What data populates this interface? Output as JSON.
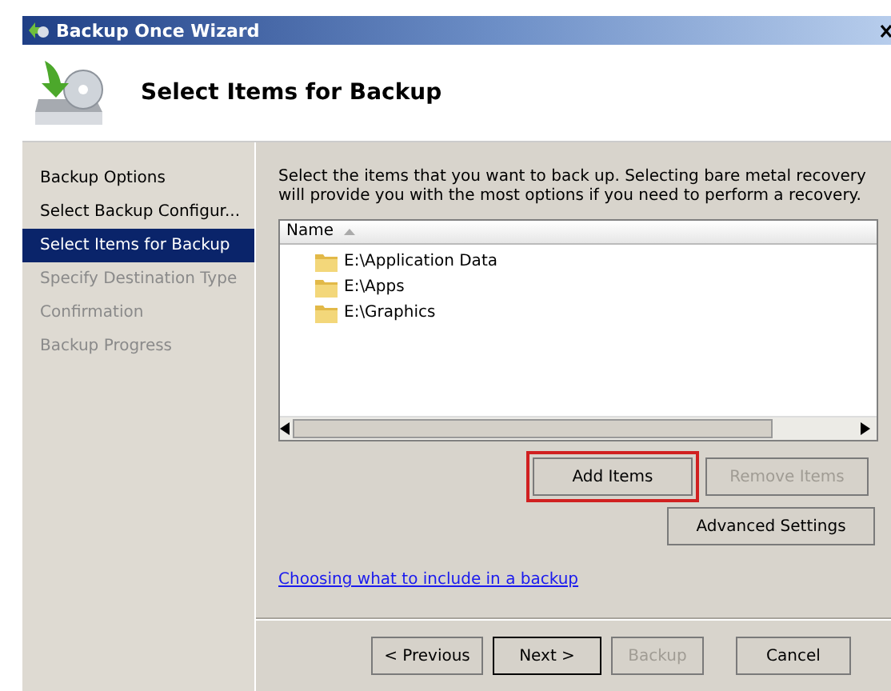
{
  "window": {
    "title": "Backup Once Wizard"
  },
  "header": {
    "title": "Select Items for Backup"
  },
  "sidebar": {
    "items": [
      {
        "label": "Backup Options",
        "selected": false,
        "disabled": false
      },
      {
        "label": "Select Backup Configur...",
        "selected": false,
        "disabled": false
      },
      {
        "label": "Select Items for Backup",
        "selected": true,
        "disabled": false
      },
      {
        "label": "Specify Destination Type",
        "selected": false,
        "disabled": true
      },
      {
        "label": "Confirmation",
        "selected": false,
        "disabled": true
      },
      {
        "label": "Backup Progress",
        "selected": false,
        "disabled": true
      }
    ]
  },
  "description": "Select the items that you want to back up. Selecting bare metal recovery will provide you with the most options if you need to perform a recovery.",
  "list": {
    "columns": [
      "Name"
    ],
    "rows": [
      "E:\\Application Data",
      "E:\\Apps",
      "E:\\Graphics"
    ]
  },
  "item_buttons": [
    {
      "label": "Add Items",
      "disabled": false,
      "highlighted": true
    },
    {
      "label": "Remove Items",
      "disabled": true,
      "highlighted": false
    }
  ],
  "advanced_button": {
    "label": "Advanced Settings"
  },
  "help_link": "Choosing what to include in a backup",
  "nav_buttons": [
    {
      "label": "< Previous",
      "disabled": false,
      "default": false
    },
    {
      "label": "Next >",
      "disabled": false,
      "default": true
    },
    {
      "label": "Backup",
      "disabled": true,
      "default": false
    },
    {
      "label": "Cancel",
      "disabled": false,
      "default": false
    }
  ]
}
